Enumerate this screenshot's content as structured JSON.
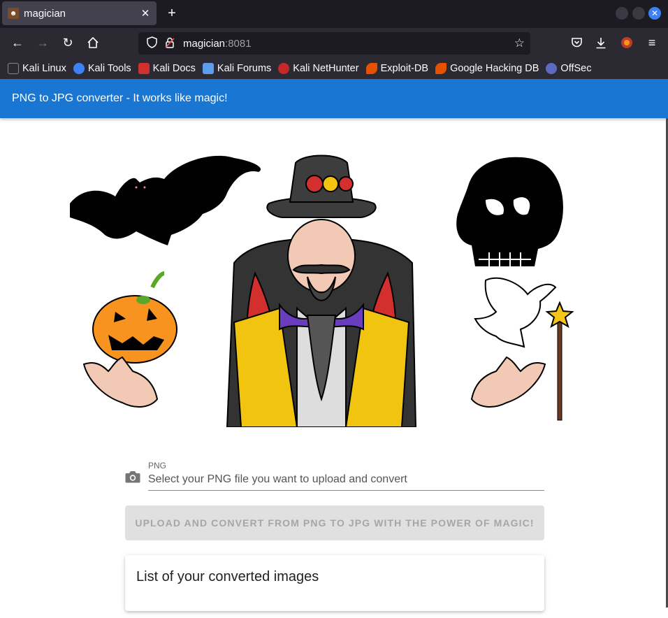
{
  "browser": {
    "tab_title": "magician",
    "url_host": "magician",
    "url_port": ":8081",
    "bookmarks": [
      {
        "label": "Kali Linux",
        "icon": "kali-dragon-icon",
        "color": "#2b2a33"
      },
      {
        "label": "Kali Tools",
        "icon": "kali-tools-icon",
        "color": "#3b82f6"
      },
      {
        "label": "Kali Docs",
        "icon": "kali-docs-icon",
        "color": "#d32f2f"
      },
      {
        "label": "Kali Forums",
        "icon": "kali-forums-icon",
        "color": "#5c9ded"
      },
      {
        "label": "Kali NetHunter",
        "icon": "nethunter-icon",
        "color": "#c62828"
      },
      {
        "label": "Exploit-DB",
        "icon": "exploit-db-icon",
        "color": "#e65100"
      },
      {
        "label": "Google Hacking DB",
        "icon": "ghdb-icon",
        "color": "#e65100"
      },
      {
        "label": "OffSec",
        "icon": "offsec-icon",
        "color": "#5c6bc0"
      }
    ]
  },
  "app": {
    "title": "PNG to JPG converter - It works like magic!",
    "file_input": {
      "label": "PNG",
      "placeholder": "Select your PNG file you want to upload and convert"
    },
    "convert_button": "UPLOAD AND CONVERT FROM PNG TO JPG WITH THE POWER OF MAGIC!",
    "list_title": "List of your converted images",
    "colors": {
      "primary": "#1976d2",
      "button_disabled_bg": "#e0e0e0",
      "button_disabled_text": "#a6a6a6"
    }
  }
}
